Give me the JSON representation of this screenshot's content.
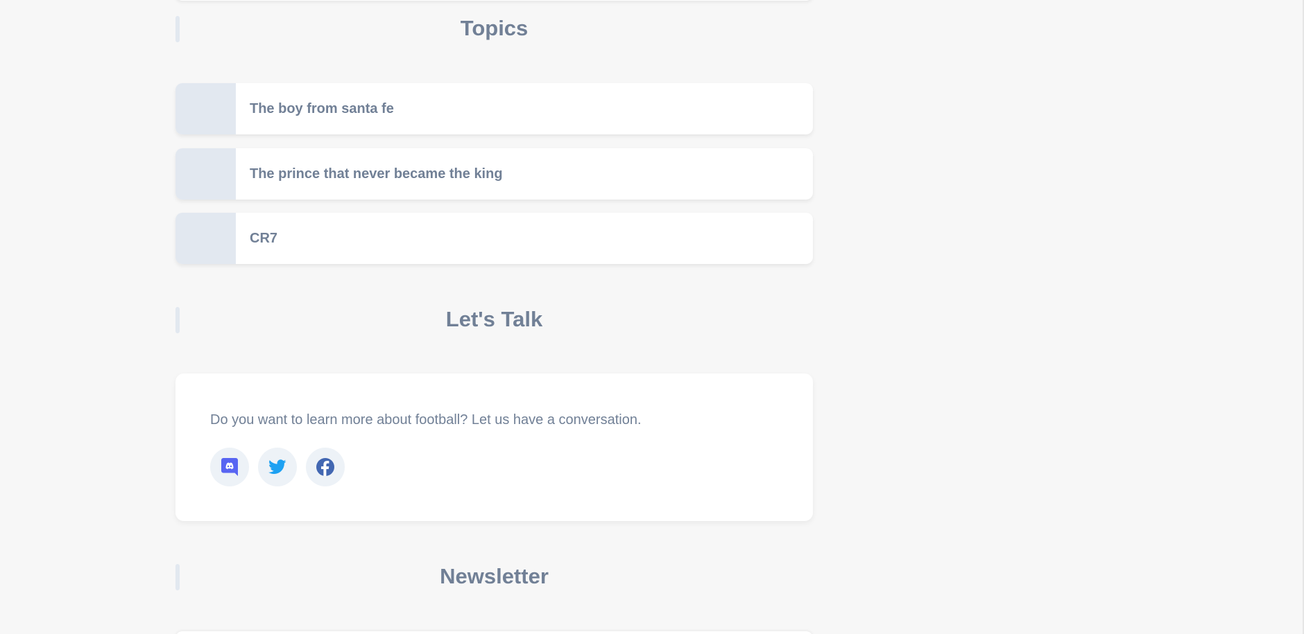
{
  "sections": {
    "topics": {
      "heading": "Topics",
      "items": [
        {
          "label": "The boy from santa fe"
        },
        {
          "label": "The prince that never became the king"
        },
        {
          "label": "CR7"
        }
      ]
    },
    "talk": {
      "heading": "Let's Talk",
      "text": "Do you want to learn more about football? Let us have a conversation.",
      "socials": [
        {
          "icon": "discord-icon",
          "color": "#5865F2"
        },
        {
          "icon": "twitter-icon",
          "color": "#1DA1F2"
        },
        {
          "icon": "facebook-icon",
          "color": "#4267B2"
        }
      ]
    },
    "newsletter": {
      "heading": "Newsletter"
    }
  },
  "colors": {
    "background": "#f7f7f7",
    "card": "#ffffff",
    "text": "#718096",
    "accent_muted": "#e2e8f0"
  }
}
